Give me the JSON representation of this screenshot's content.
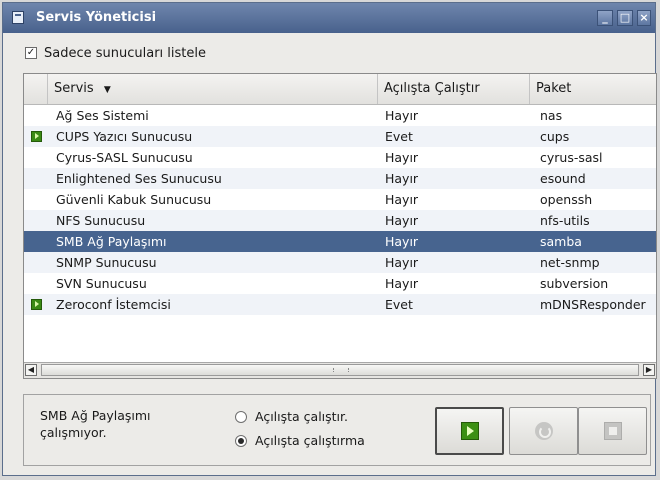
{
  "window": {
    "title": "Servis Yöneticisi",
    "controls": [
      "minimize-icon",
      "maximize-icon",
      "close-icon"
    ]
  },
  "filter": {
    "label": "Sadece sunucuları listele",
    "checked": true,
    "check_glyph": "✓"
  },
  "table": {
    "columns": [
      "Servis",
      "Açılışta Çalıştır",
      "Paket"
    ],
    "sort_glyph": "▼",
    "rows": [
      {
        "service": "Ağ Ses Sistemi",
        "autostart": "Hayır",
        "package": "nas",
        "running": false
      },
      {
        "service": "CUPS Yazıcı Sunucusu",
        "autostart": "Evet",
        "package": "cups",
        "running": true
      },
      {
        "service": "Cyrus-SASL Sunucusu",
        "autostart": "Hayır",
        "package": "cyrus-sasl",
        "running": false
      },
      {
        "service": "Enlightened Ses Sunucusu",
        "autostart": "Hayır",
        "package": "esound",
        "running": false
      },
      {
        "service": "Güvenli Kabuk Sunucusu",
        "autostart": "Hayır",
        "package": "openssh",
        "running": false
      },
      {
        "service": "NFS Sunucusu",
        "autostart": "Hayır",
        "package": "nfs-utils",
        "running": false
      },
      {
        "service": "SMB Ağ Paylaşımı",
        "autostart": "Hayır",
        "package": "samba",
        "running": false,
        "selected": true
      },
      {
        "service": "SNMP Sunucusu",
        "autostart": "Hayır",
        "package": "net-snmp",
        "running": false
      },
      {
        "service": "SVN Sunucusu",
        "autostart": "Hayır",
        "package": "subversion",
        "running": false
      },
      {
        "service": "Zeroconf İstemcisi",
        "autostart": "Evet",
        "package": "mDNSResponder",
        "running": true
      }
    ]
  },
  "scrollbar": {
    "left_glyph": "◀",
    "right_glyph": "▶"
  },
  "status": {
    "text": "SMB Ağ Paylaşımı çalışmıyor.",
    "radio_start": "Açılışta çalıştır.",
    "radio_nostart": "Açılışta çalıştırma",
    "selected_option": "nostart"
  },
  "actions": {
    "start_icon": "play-icon",
    "restart_icon": "restart-icon",
    "stop_icon": "stop-icon"
  },
  "colors": {
    "titlebar": "#48618c",
    "selection": "#47648f",
    "running_icon": "#3c8f14"
  }
}
